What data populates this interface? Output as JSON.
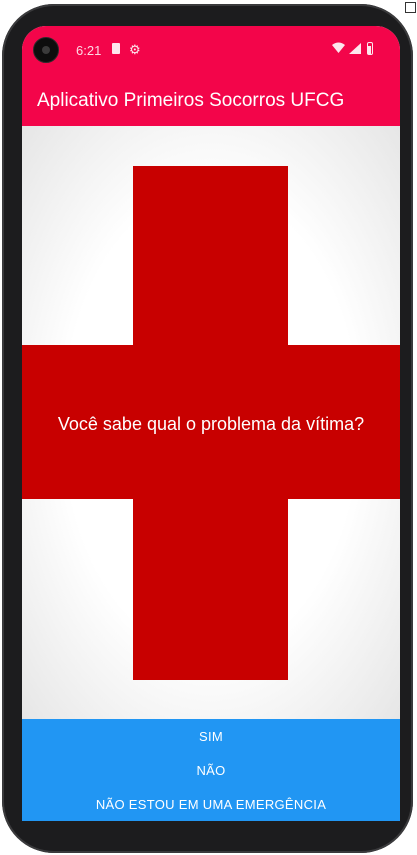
{
  "status_bar": {
    "time": "6:21"
  },
  "app_bar": {
    "title": "Aplicativo Primeiros Socorros UFCG"
  },
  "main": {
    "question": "Você sabe qual o problema da vítima?"
  },
  "buttons": {
    "yes": "SIM",
    "no": "NÃO",
    "not_emergency": "NÃO ESTOU EM UMA EMERGÊNCIA"
  },
  "colors": {
    "app_bar": "#f3054a",
    "cross": "#c80000",
    "buttons": "#2196f3"
  },
  "icons": {
    "status_left": [
      "camera-icon",
      "sim-card-icon",
      "settings-gear-icon"
    ],
    "status_right": [
      "wifi-icon",
      "signal-icon",
      "battery-icon"
    ]
  }
}
